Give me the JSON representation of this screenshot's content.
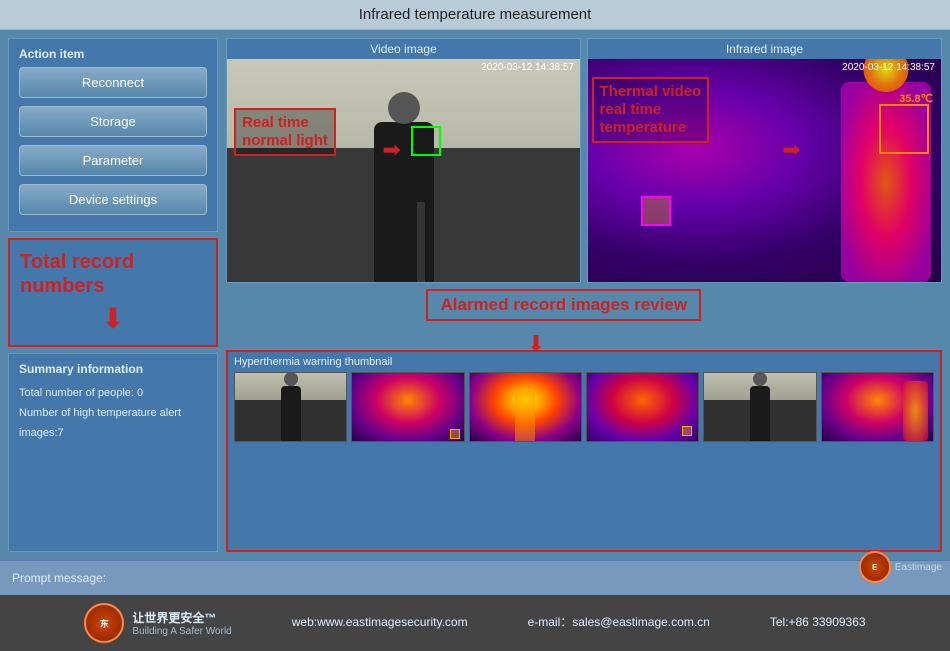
{
  "title": "Infrared temperature measurement",
  "left_panel": {
    "action_label": "Action item",
    "buttons": [
      "Reconnect",
      "Storage",
      "Parameter",
      "Device settings"
    ],
    "record_label": "Total record numbers",
    "summary_label": "Summary information",
    "summary_people": "Total number of people:  0",
    "summary_alert": "Number of high temperature alert images:7"
  },
  "video_section": {
    "video_label": "Video image",
    "infrared_label": "Infrared image",
    "timestamp1": "2020-03-12 14:38:57",
    "timestamp2": "2020-03-12 14:38:57",
    "normal_annotation": "Real time\nnormal light",
    "thermal_annotation": "Thermal video\nreal time\ntemperature",
    "temp_value": "35.8℃",
    "alarmed_label": "Alarmed record\nimages review"
  },
  "thumbnail_section": {
    "label": "Hyperthermia warning thumbnail"
  },
  "prompt": {
    "label": "Prompt message:"
  },
  "footer": {
    "web": "web:www.eastimagesecurity.com",
    "email": "e-mail：sales@eastimage.com.cn",
    "tel": "Tel:+86 33909363",
    "brand": "让世界更安全™",
    "sub_brand": "Building A Safer World",
    "watermark": "Eastimage"
  }
}
